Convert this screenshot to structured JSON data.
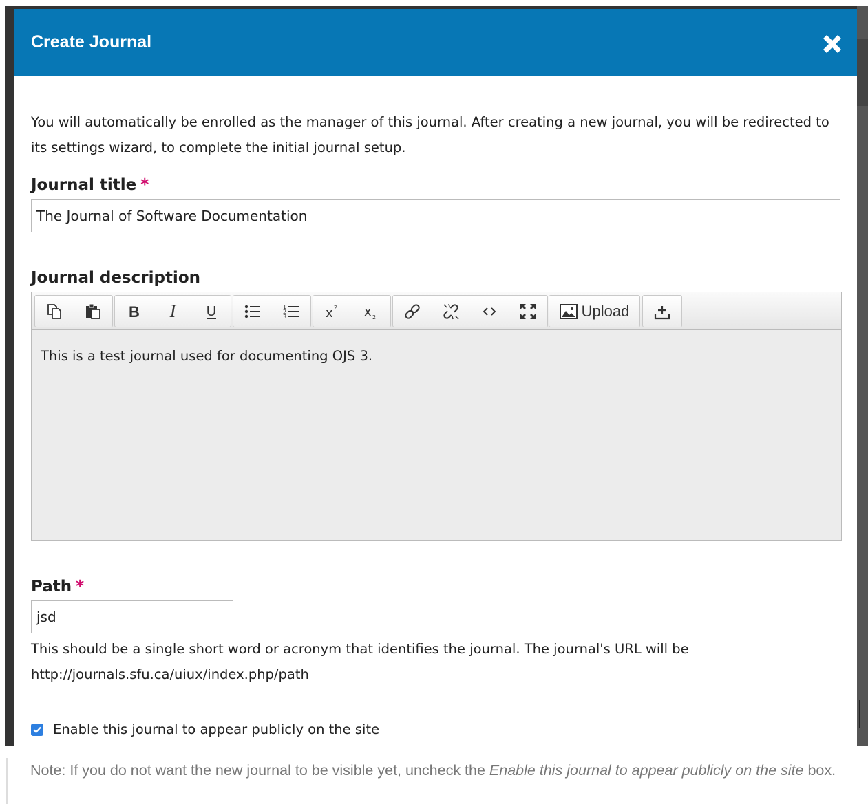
{
  "dialog": {
    "title": "Create Journal",
    "close_label": "Close",
    "intro": "You will automatically be enrolled as the manager of this journal. After creating a new journal, you will be redirected to its settings wizard, to complete the initial journal setup."
  },
  "fields": {
    "title": {
      "label": "Journal title",
      "required": "*",
      "value": "The Journal of Software Documentation"
    },
    "description": {
      "label": "Journal description",
      "content": "This is a test journal used for documenting OJS 3.",
      "toolbar": {
        "groups": [
          [
            "copy-icon",
            "paste-icon"
          ],
          [
            "bold-icon",
            "italic-icon",
            "underline-icon"
          ],
          [
            "bullet-list-icon",
            "numbered-list-icon"
          ],
          [
            "superscript-icon",
            "subscript-icon"
          ],
          [
            "link-icon",
            "unlink-icon",
            "code-icon",
            "fullscreen-icon"
          ],
          [
            "image-icon"
          ],
          [
            "upload-icon"
          ]
        ],
        "upload_label": "Upload"
      }
    },
    "path": {
      "label": "Path",
      "required": "*",
      "value": "jsd",
      "help_line1": "This should be a single short word or acronym that identifies the journal. The journal's URL will be",
      "help_line2": "http://journals.sfu.ca/uiux/index.php/path"
    },
    "enable": {
      "checked": true,
      "label": "Enable this journal to appear publicly on the site"
    }
  },
  "note": {
    "prefix": "Note: If you do not want the new journal to be visible yet, uncheck the ",
    "emphasis": "Enable this journal to appear publicly on the site",
    "suffix": " box."
  },
  "colors": {
    "header": "#0777b5",
    "required": "#d00a6c",
    "checkbox": "#2d7fe0",
    "editor_bg": "#ececec"
  }
}
